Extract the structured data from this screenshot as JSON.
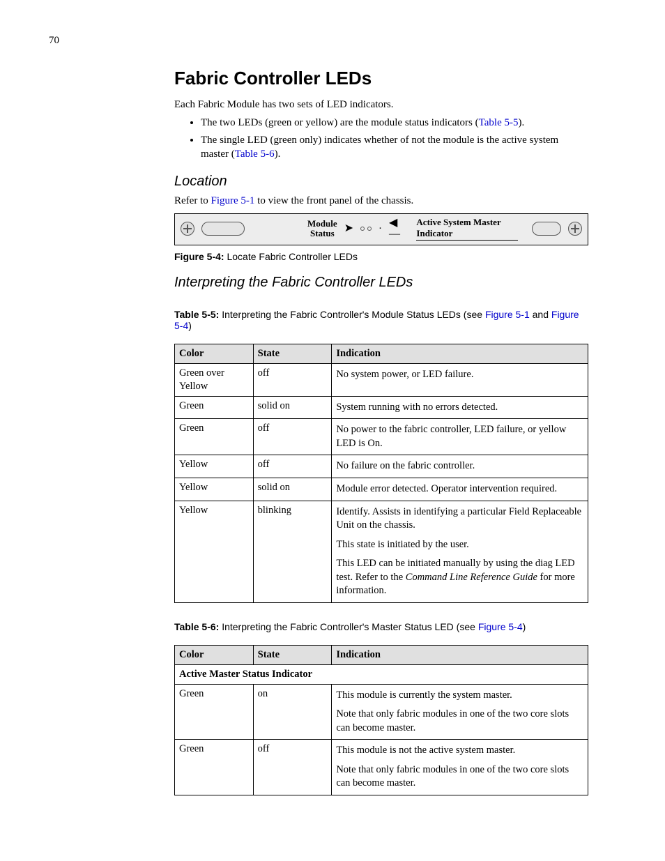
{
  "page_number": "70",
  "h1": "Fabric Controller LEDs",
  "intro": "Each Fabric Module has two sets of LED indicators.",
  "bullets": [
    {
      "pre": "The two LEDs (green or yellow) are the module status indicators (",
      "ref": "Table 5-5",
      "post": ")."
    },
    {
      "pre": "The single LED (green only) indicates whether of not the module is the active system master (",
      "ref": "Table 5-6",
      "post": ")."
    }
  ],
  "location": {
    "heading": "Location",
    "text_pre": "Refer to ",
    "ref": "Figure 5-1",
    "text_post": " to view the front panel of the chassis."
  },
  "figure": {
    "module_status_l1": "Module",
    "module_status_l2": "Status",
    "asm_label": "Active System Master Indicator",
    "caption_label": "Figure 5-4:",
    "caption_text": " Locate Fabric Controller LEDs"
  },
  "h2_interpret": "Interpreting the Fabric Controller LEDs",
  "table55": {
    "caption_label": "Table 5-5:",
    "caption_text": " Interpreting the Fabric Controller's Module Status LEDs (see ",
    "ref1": "Figure 5-1",
    "mid": " and ",
    "ref2": "Figure 5-4",
    "end": ")",
    "headers": {
      "c1": "Color",
      "c2": "State",
      "c3": "Indication"
    },
    "rows": [
      {
        "color": "Green over Yellow",
        "state": "off",
        "ind": [
          "No system power, or LED failure."
        ]
      },
      {
        "color": "Green",
        "state": "solid on",
        "ind": [
          "System running with no errors detected."
        ]
      },
      {
        "color": "Green",
        "state": "off",
        "ind": [
          "No power to the fabric controller, LED failure, or yellow LED is On."
        ]
      },
      {
        "color": "Yellow",
        "state": "off",
        "ind": [
          "No failure on the fabric controller."
        ]
      },
      {
        "color": "Yellow",
        "state": "solid on",
        "ind": [
          "Module error detected. Operator intervention required."
        ]
      },
      {
        "color": "Yellow",
        "state": "blinking",
        "ind": [
          "Identify. Assists in identifying a particular Field Replaceable Unit on the chassis.",
          "This state is initiated by the user.",
          "This LED can be initiated manually by using the diag LED test. Refer to the <span class=\"italic\">Command Line Reference Guide</span> for more information."
        ]
      }
    ]
  },
  "table56": {
    "caption_label": "Table 5-6:",
    "caption_text": " Interpreting the Fabric Controller's Master Status LED (see ",
    "ref": "Figure 5-4",
    "end": ")",
    "headers": {
      "c1": "Color",
      "c2": "State",
      "c3": "Indication"
    },
    "subhead": "Active Master Status Indicator",
    "rows": [
      {
        "color": "Green",
        "state": "on",
        "ind": [
          "This module is currently the system master.",
          "Note that only fabric modules in one of the two core slots can become master."
        ]
      },
      {
        "color": "Green",
        "state": "off",
        "ind": [
          "This module is not the active system master.",
          "Note that only fabric modules in one of the two core slots can become master."
        ]
      }
    ]
  }
}
